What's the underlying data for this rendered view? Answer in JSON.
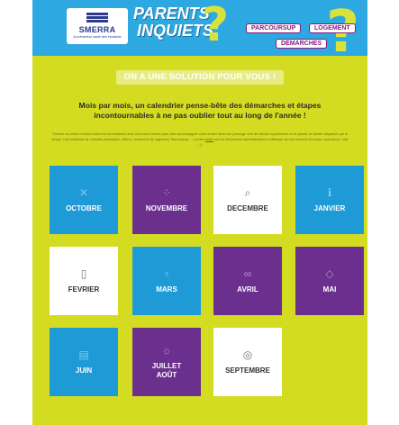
{
  "header": {
    "logo_name": "SMERRA",
    "logo_tagline": "la prévention santé des étudiants",
    "title_line1": "PARENTS",
    "title_line2": "INQUIETS",
    "nav": [
      "PARCOURSUP",
      "LOGEMENT",
      "DÉMARCHES"
    ]
  },
  "main": {
    "banner": "ON A UNE SOLUTION POUR VOUS !",
    "heading_line1": "Mois par mois, un calendrier pense-bête des démarches et étapes",
    "heading_line2": "incontournables à ne pas oublier tout au long de l'année !",
    "intro_part1": "Trouvez au même endroit toutes les informations dont vous avez besoin pour bien accompagner votre enfant dans son passage vers les",
    "intro_part2": "études supérieures et ne jamais se laisser dépasser par le temps. Une multitude de conseils (orientation, filières, recherche de logement,",
    "intro_part3": "Parcoursup, ...) et des",
    "intro_link": "aides",
    "intro_part4": "sur les démarches administratives à effectuer au bon moment (bourses, assurance, bail, ...) !"
  },
  "months": [
    {
      "label": "OCTOBRE",
      "icon": "tools-icon"
    },
    {
      "label": "NOVEMBRE",
      "icon": "network-icon"
    },
    {
      "label": "DECEMBRE",
      "icon": "search-icon"
    },
    {
      "label": "JANVIER",
      "icon": "info-icon"
    },
    {
      "label": "FEVRIER",
      "icon": "clipboard-icon"
    },
    {
      "label": "MARS",
      "icon": "lightbulb-icon"
    },
    {
      "label": "AVRIL",
      "icon": "link-icon"
    },
    {
      "label": "MAI",
      "icon": "graduation-cap-icon"
    },
    {
      "label": "JUIN",
      "icon": "calendar-icon"
    },
    {
      "label": "JUILLET",
      "label2": "AOÛT",
      "icon": "sun-icon"
    },
    {
      "label": "SEPTEMBRE",
      "icon": "target-icon"
    }
  ],
  "colors": {
    "header_blue": "#2ea8e0",
    "lime": "#d4dc22",
    "tile_blue": "#1e9ad6",
    "tile_purple": "#6b2f8e",
    "tile_white": "#ffffff",
    "nav_magenta": "#8a1c7c"
  }
}
